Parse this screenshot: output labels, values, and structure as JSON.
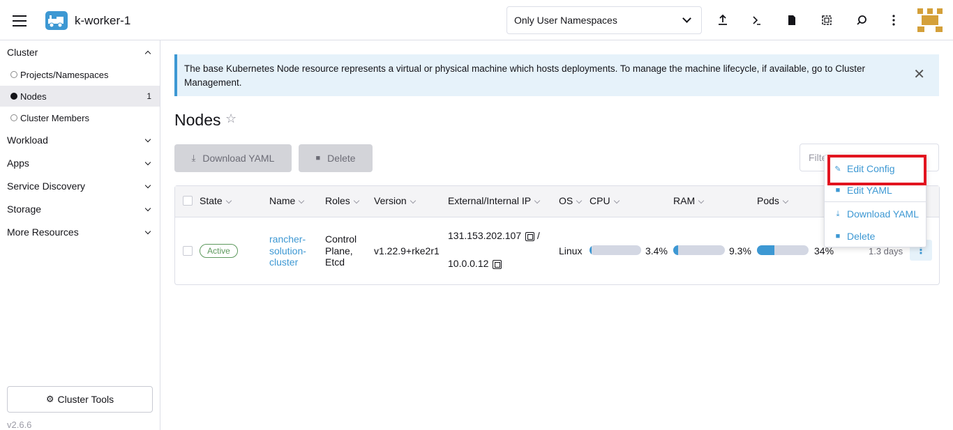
{
  "header": {
    "cluster_name": "k-worker-1",
    "namespace_filter": "Only User Namespaces"
  },
  "sidebar": {
    "groups": [
      {
        "label": "Cluster",
        "expanded": true
      },
      {
        "label": "Workload"
      },
      {
        "label": "Apps"
      },
      {
        "label": "Service Discovery"
      },
      {
        "label": "Storage"
      },
      {
        "label": "More Resources"
      }
    ],
    "cluster_items": [
      {
        "label": "Projects/Namespaces"
      },
      {
        "label": "Nodes",
        "count": "1",
        "active": true
      },
      {
        "label": "Cluster Members"
      }
    ],
    "tools_label": "Cluster Tools",
    "version": "v2.6.6"
  },
  "banner": {
    "text": "The base Kubernetes Node resource represents a virtual or physical machine which hosts deployments. To manage the machine lifecycle, if available, go to Cluster Management."
  },
  "page": {
    "title": "Nodes",
    "download_yaml_label": "Download YAML",
    "delete_label": "Delete",
    "filter_placeholder": "Filter"
  },
  "table": {
    "columns": [
      "State",
      "Name",
      "Roles",
      "Version",
      "External/Internal IP",
      "OS",
      "CPU",
      "RAM",
      "Pods"
    ],
    "rows": [
      {
        "state": "Active",
        "name_lines": [
          "rancher-",
          "solution-",
          "cluster"
        ],
        "roles_lines": [
          "Control",
          "Plane,",
          "Etcd"
        ],
        "version": "v1.22.9+rke2r1",
        "external_ip": "131.153.202.107",
        "ip_separator": "/",
        "internal_ip": "10.0.0.12",
        "os": "Linux",
        "cpu": {
          "percent": 3.4,
          "label": "3.4%"
        },
        "ram": {
          "percent": 9.3,
          "label": "9.3%"
        },
        "pods": {
          "percent": 34,
          "label": "34%"
        },
        "age": "1.3 days"
      }
    ]
  },
  "action_menu": {
    "items": [
      "Edit Config",
      "Edit YAML",
      "Download YAML",
      "Delete"
    ],
    "highlighted": "Edit Config"
  },
  "colors": {
    "accent": "#3d98d3",
    "active_badge": "#5d995d",
    "highlight_box": "#e2141f"
  }
}
